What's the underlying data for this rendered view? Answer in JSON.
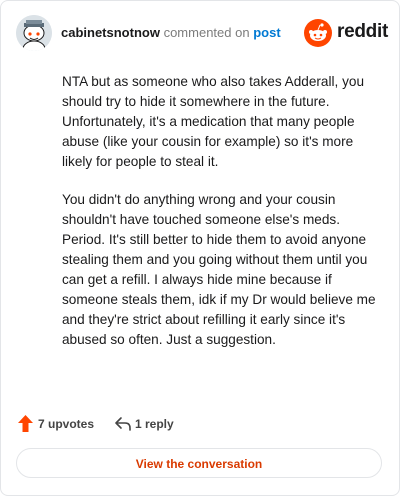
{
  "header": {
    "username": "cabinetsnotnow",
    "commented_on": "commented on",
    "post_link": "post",
    "brand_word": "reddit"
  },
  "comment": {
    "paragraphs": [
      "NTA but as someone who also takes Adderall, you should try to hide it somewhere in the future. Unfortunately, it's a medication that many people abuse (like your cousin for example) so it's more likely for people to steal it.",
      "You didn't do anything wrong and your cousin shouldn't have touched someone else's meds. Period. It's still better to hide them to avoid anyone stealing them and you going without them until you can get a refill. I always hide mine because if someone steals them, idk if my Dr would believe me and they're strict about refilling it early since it's abused so often. Just a suggestion."
    ]
  },
  "actions": {
    "upvotes": "7 upvotes",
    "replies": "1 reply"
  },
  "footer": {
    "view_conversation": "View the conversation"
  },
  "colors": {
    "brand_orange": "#ff4500",
    "link_blue": "#0079d3",
    "button_text": "#d93a00"
  },
  "icons": [
    "snoo-avatar-icon",
    "reddit-logo-icon",
    "upvote-arrow-icon",
    "reply-arrow-icon"
  ]
}
